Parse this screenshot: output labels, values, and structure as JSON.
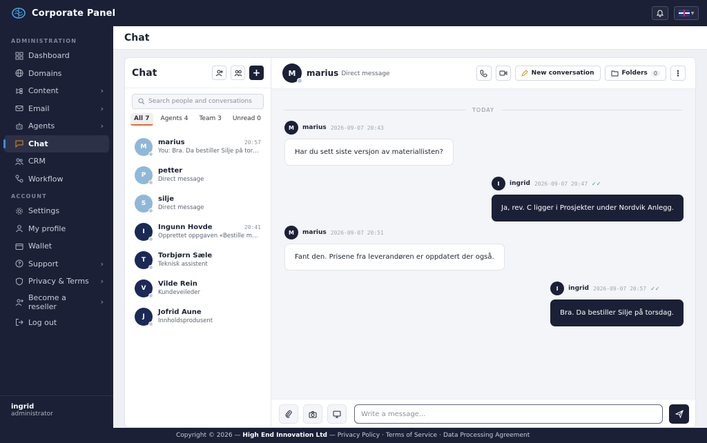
{
  "app": {
    "title": "Corporate Panel"
  },
  "sidebar": {
    "section_admin": "ADMINISTRATION",
    "section_account": "ACCOUNT",
    "admin_items": [
      {
        "label": "Dashboard",
        "icon": "dashboard-icon"
      },
      {
        "label": "Domains",
        "icon": "globe-icon"
      },
      {
        "label": "Content",
        "icon": "content-icon",
        "has_submenu": true
      },
      {
        "label": "Email",
        "icon": "mail-icon",
        "has_submenu": true
      },
      {
        "label": "Agents",
        "icon": "agent-icon",
        "has_submenu": true
      },
      {
        "label": "Chat",
        "icon": "chat-icon",
        "active": true
      },
      {
        "label": "CRM",
        "icon": "users-icon"
      },
      {
        "label": "Workflow",
        "icon": "workflow-icon"
      }
    ],
    "account_items": [
      {
        "label": "Settings",
        "icon": "gear-icon"
      },
      {
        "label": "My profile",
        "icon": "user-icon"
      },
      {
        "label": "Wallet",
        "icon": "wallet-icon"
      },
      {
        "label": "Support",
        "icon": "help-icon",
        "has_submenu": true
      },
      {
        "label": "Privacy & Terms",
        "icon": "shield-icon",
        "has_submenu": true
      },
      {
        "label": "Become a reseller",
        "label_line1": "Become a",
        "label_line2": "reseller",
        "icon": "add-user-icon",
        "has_submenu": true
      },
      {
        "label": "Log out",
        "icon": "logout-icon"
      }
    ],
    "user": {
      "name": "ingrid",
      "role": "administrator"
    }
  },
  "page": {
    "title": "Chat"
  },
  "chatlist": {
    "title": "Chat",
    "search_placeholder": "Search people and conversations",
    "filters": [
      {
        "label": "All 7",
        "active": true
      },
      {
        "label": "Agents 4"
      },
      {
        "label": "Team 3"
      },
      {
        "label": "Unread 0"
      }
    ],
    "conversations": [
      {
        "initial": "M",
        "name": "marius",
        "time": "20:57",
        "preview": "You: Bra. Da bestiller Silje på torsdag.",
        "style": "light"
      },
      {
        "initial": "P",
        "name": "petter",
        "time": "",
        "preview": "Direct message",
        "style": "light"
      },
      {
        "initial": "S",
        "name": "silje",
        "time": "",
        "preview": "Direct message",
        "style": "light"
      },
      {
        "initial": "I",
        "name": "Ingunn Hovde",
        "time": "20:41",
        "preview": "Opprettet oppgaven «Bestille materi…",
        "style": "dark"
      },
      {
        "initial": "T",
        "name": "Torbjørn Sæle",
        "time": "",
        "preview": "Teknisk assistent",
        "style": "dark"
      },
      {
        "initial": "V",
        "name": "Vilde Rein",
        "time": "",
        "preview": "Kundeveileder",
        "style": "dark"
      },
      {
        "initial": "J",
        "name": "Jofrid Aune",
        "time": "",
        "preview": "Innholdsprodusent",
        "style": "dark"
      }
    ]
  },
  "conversation": {
    "initial": "M",
    "name": "marius",
    "subtitle": "Direct message",
    "new_conversation_label": "New conversation",
    "folders_label": "Folders",
    "folders_count": "0",
    "day_divider": "TODAY",
    "messages": [
      {
        "initial": "M",
        "author": "marius",
        "time": "2026-09-07 20:43",
        "text": "Har du sett siste versjon av materiallisten?",
        "outgoing": false
      },
      {
        "initial": "I",
        "author": "ingrid",
        "time": "2026-09-07 20:47",
        "text": "Ja, rev. C ligger i Prosjekter under Nordvik Anlegg.",
        "outgoing": true,
        "ticks": "✓✓"
      },
      {
        "initial": "M",
        "author": "marius",
        "time": "2026-09-07 20:51",
        "text": "Fant den. Prisene fra leverandøren er oppdatert der også.",
        "outgoing": false
      },
      {
        "initial": "I",
        "author": "ingrid",
        "time": "2026-09-07 20:57",
        "text": "Bra. Da bestiller Silje på torsdag.",
        "outgoing": true,
        "ticks": "✓✓"
      }
    ],
    "composer_placeholder": "Write a message..."
  },
  "footer": {
    "copyright": "Copyright © 2026 —",
    "company": "High End Innovation Ltd",
    "dash": "—",
    "privacy": "Privacy Policy",
    "terms": "Terms of Service",
    "dpa": "Data Processing Agreement",
    "sep": "·"
  }
}
